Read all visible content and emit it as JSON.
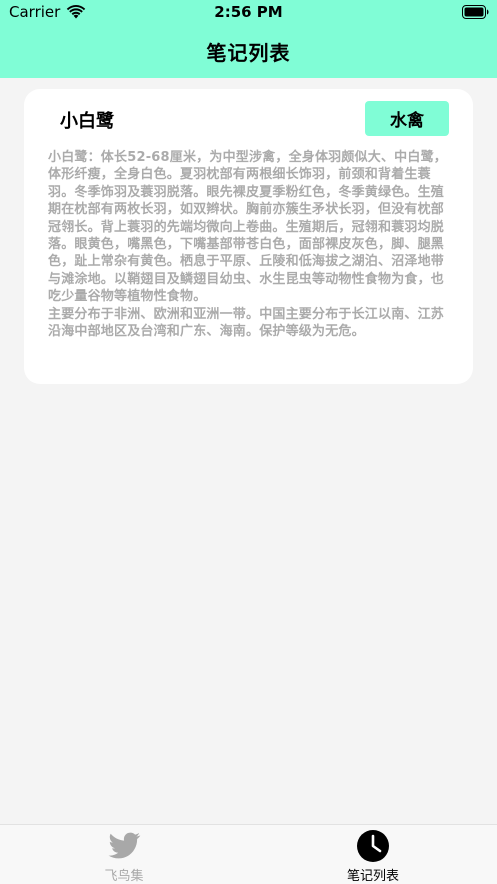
{
  "status_bar": {
    "carrier": "Carrier",
    "time": "2:56 PM"
  },
  "nav": {
    "title": "笔记列表"
  },
  "note": {
    "title": "小白鹭",
    "category": "水禽",
    "description": "小白鹭：体长52-68厘米，为中型涉禽，全身体羽颇似大、中白鹭，体形纤瘦，全身白色。夏羽枕部有两根细长饰羽，前颈和背着生蓑羽。冬季饰羽及蓑羽脱落。眼先裸皮夏季粉红色，冬季黄绿色。生殖期在枕部有两枚长羽，如双辫状。胸前亦簇生矛状长羽，但没有枕部冠翎长。背上蓑羽的先端均微向上卷曲。生殖期后，冠翎和蓑羽均脱落。眼黄色，嘴黑色，下嘴基部带苍白色，面部裸皮灰色，脚、腿黑色，趾上常杂有黄色。栖息于平原、丘陵和低海拔之湖泊、沼泽地带与滩涂地。以鞘翅目及鳞翅目幼虫、水生昆虫等动物性食物为食，也吃少量谷物等植物性食物。\n主要分布于非洲、欧洲和亚洲一带。中国主要分布于长江以南、江苏沿海中部地区及台湾和广东、海南。保护等级为无危。"
  },
  "tabs": [
    {
      "label": "飞鸟集",
      "icon": "bird-icon",
      "selected": false
    },
    {
      "label": "笔记列表",
      "icon": "clock-icon",
      "selected": true
    }
  ],
  "colors": {
    "accent": "#80fdd6",
    "background": "#f4f4f4",
    "card": "#ffffff",
    "muted_text": "#ababab"
  }
}
